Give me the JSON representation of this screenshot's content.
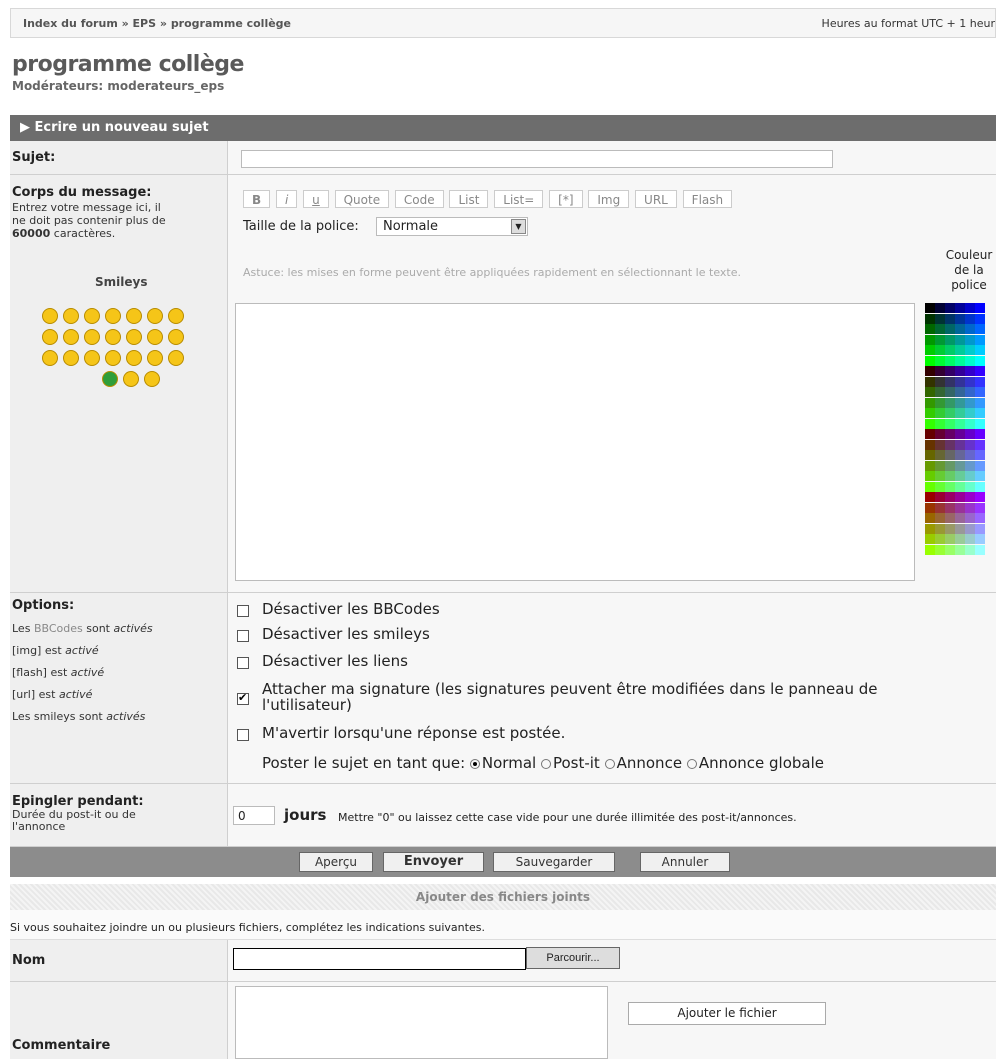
{
  "breadcrumb": {
    "index": "Index du forum",
    "sep1": " » ",
    "eps": "EPS",
    "sep2": " » ",
    "page": "programme collège"
  },
  "timezone": "Heures au format UTC + 1 heur",
  "forum": {
    "title": "programme collège",
    "moderators": "Modérateurs: moderateurs_eps"
  },
  "section_title": "▶ Ecrire un nouveau sujet",
  "subject": {
    "label": "Sujet:",
    "value": ""
  },
  "body": {
    "label": "Corps du message:",
    "help1": "Entrez votre message ici, il",
    "help2": "ne doit pas contenir plus de",
    "help3_bold": "60000",
    "help3_rest": " caractères.",
    "smileys_label": "Smileys"
  },
  "toolbar": {
    "b": "B",
    "i": "i",
    "u": "u",
    "quote": "Quote",
    "code": "Code",
    "list": "List",
    "list_eq": "List=",
    "star": "[*]",
    "img": "Img",
    "url": "URL",
    "flash": "Flash"
  },
  "font_size": {
    "label": "Taille de la police:",
    "value": "Normale"
  },
  "tip": "Astuce: les mises en forme peuvent être appliquées rapidement en sélectionnant le texte.",
  "color_label": [
    "Couleur",
    "de la",
    "police"
  ],
  "options": {
    "label": "Options:",
    "bbcodes_prefix": "Les ",
    "bbcodes_link": "BBCodes",
    "bbcodes_mid": " sont ",
    "bbcodes_state": "activés",
    "img": "[img] est ",
    "img_state": "activé",
    "flash": "[flash] est ",
    "flash_state": "activé",
    "url": "[url] est ",
    "url_state": "activé",
    "smileys": "Les smileys sont ",
    "smileys_state": "activés",
    "items": [
      {
        "text": "Désactiver les BBCodes",
        "checked": false
      },
      {
        "text": "Désactiver les smileys",
        "checked": false
      },
      {
        "text": "Désactiver les liens",
        "checked": false
      },
      {
        "text": "Attacher ma signature (les signatures peuvent être modifiées dans le panneau de",
        "text2": "l'utilisateur)",
        "checked": true
      },
      {
        "text": "M'avertir lorsqu'une réponse est postée.",
        "checked": false
      }
    ],
    "post_as_label": "Poster le sujet en tant que:",
    "post_types": [
      "Normal",
      "Post-it",
      "Annonce",
      "Annonce globale"
    ],
    "post_type_selected": "Normal"
  },
  "pin": {
    "label": "Epingler pendant:",
    "help1": "Durée du post-it ou de",
    "help2": "l'annonce",
    "value": "0",
    "unit": "jours",
    "note": "Mettre \"0\" ou laissez cette case vide pour une durée illimitée des post-it/annonces."
  },
  "buttons": {
    "preview": "Aperçu",
    "send": "Envoyer",
    "save": "Sauvegarder",
    "cancel": "Annuler"
  },
  "attach": {
    "title": "Ajouter des fichiers joints",
    "intro": "Si vous souhaitez joindre un ou plusieurs fichiers, complétez les indications suivantes.",
    "name_label": "Nom",
    "browse": "Parcourir...",
    "comment_label": "Commentaire",
    "add_button": "Ajouter le fichier"
  }
}
